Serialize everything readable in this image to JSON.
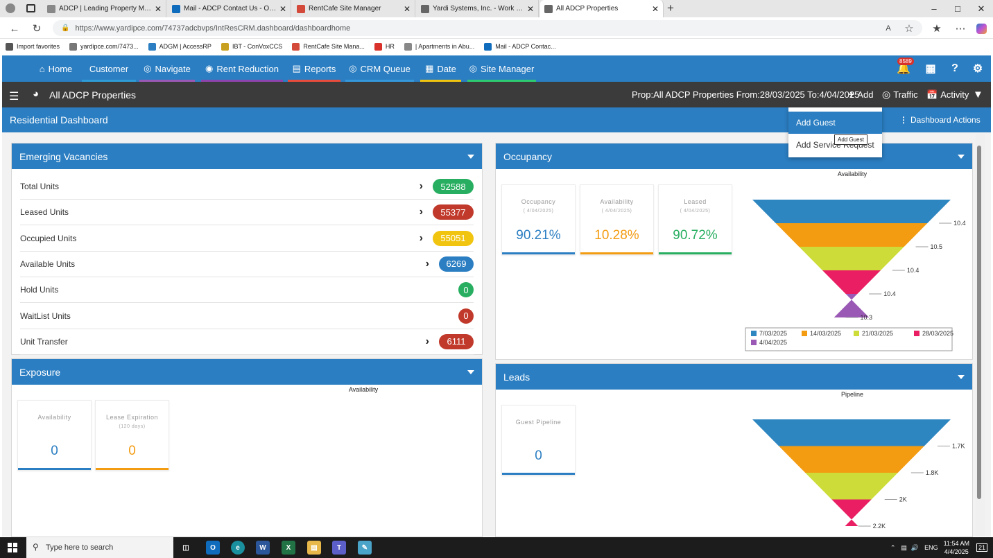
{
  "browser": {
    "tabs": [
      {
        "label": "ADCP | Leading Property Manage",
        "icon": "play-icon",
        "icon_color": "#888888"
      },
      {
        "label": "Mail - ADCP Contact Us - Outlook",
        "icon": "outlook-icon",
        "icon_color": "#0f6cbd"
      },
      {
        "label": "RentCafe Site Manager",
        "icon": "chrome-icon",
        "icon_color": "#d44a3a"
      },
      {
        "label": "Yardi Systems, Inc. - Work Order #",
        "icon": "page-icon",
        "icon_color": "#666666"
      },
      {
        "label": "All ADCP Properties",
        "icon": "page-icon",
        "icon_color": "#666666"
      }
    ],
    "url": "https://www.yardipce.com/74737adcbvps/IntResCRM.dashboard/dashboardhome",
    "favorites": [
      {
        "label": "Import favorites",
        "icon_color": "#555555"
      },
      {
        "label": "yardipce.com/7473...",
        "icon_color": "#777777"
      },
      {
        "label": "ADGM | AccessRP",
        "icon_color": "#2b7ec2"
      },
      {
        "label": "IBT - ConVoxCCS",
        "icon_color": "#c8a020"
      },
      {
        "label": "RentCafe Site Mana...",
        "icon_color": "#d44a3a"
      },
      {
        "label": "HR",
        "icon_color": "#d9322b"
      },
      {
        "label": "| Apartments in Abu...",
        "icon_color": "#888888"
      },
      {
        "label": "Mail - ADCP Contac...",
        "icon_color": "#0f6cbd"
      }
    ]
  },
  "nav": {
    "items": [
      {
        "label": "Home",
        "icon": "home-icon",
        "underline": ""
      },
      {
        "label": "Customer",
        "icon": "",
        "underline": "#2e9cd6"
      },
      {
        "label": "Navigate",
        "icon": "compass-icon",
        "underline": "#9b59b6"
      },
      {
        "label": "Rent Reduction",
        "icon": "tag-icon",
        "underline": "#8e44ad"
      },
      {
        "label": "Reports",
        "icon": "file-icon",
        "underline": "#e74c3c"
      },
      {
        "label": "CRM Queue",
        "icon": "queue-icon",
        "underline": "#3498db"
      },
      {
        "label": "Date",
        "icon": "calendar-icon",
        "underline": "#f1c40f"
      },
      {
        "label": "Site Manager",
        "icon": "gauge-icon",
        "underline": "#2ecc71"
      }
    ],
    "notification_count": "8589"
  },
  "subbar": {
    "title": "All ADCP Properties",
    "prop_info": "Prop:All ADCP Properties From:28/03/2025 To:4/04/2025",
    "add_label": "Add",
    "traffic_label": "Traffic",
    "activity_label": "Activity"
  },
  "dashboard": {
    "title": "Residential Dashboard",
    "actions_label": "Dashboard Actions"
  },
  "dropdown": {
    "items": [
      "Add Guest",
      "Add Service Request"
    ],
    "tooltip": "Add Guest"
  },
  "emerging_vacancies": {
    "title": "Emerging Vacancies",
    "rows": [
      {
        "label": "Total Units",
        "value": "52588",
        "color": "#27ae60",
        "chevron": true
      },
      {
        "label": "Leased Units",
        "value": "55377",
        "color": "#c0392b",
        "chevron": true
      },
      {
        "label": "Occupied Units",
        "value": "55051",
        "color": "#f1c40f",
        "chevron": true
      },
      {
        "label": "Available Units",
        "value": "6269",
        "color": "#2b7ec2",
        "chevron": true
      },
      {
        "label": "Hold Units",
        "value": "0",
        "color": "#27ae60",
        "chevron": false
      },
      {
        "label": "WaitList Units",
        "value": "0",
        "color": "#c0392b",
        "chevron": false
      },
      {
        "label": "Unit Transfer",
        "value": "6111",
        "color": "#c0392b",
        "chevron": true
      }
    ]
  },
  "exposure": {
    "title": "Exposure",
    "chart_title": "Availability",
    "cards": [
      {
        "title": "Availability",
        "sub": "",
        "value": "0",
        "color": "#2b7ec2"
      },
      {
        "title": "Lease Expiration",
        "sub": "(120 days)",
        "value": "0",
        "color": "#f39c12"
      }
    ]
  },
  "occupancy": {
    "title": "Occupancy",
    "chart_title": "Availability",
    "cards": [
      {
        "title": "Occupancy",
        "sub": "( 4/04/2025)",
        "value": "90.21%",
        "color": "#2b7ec2"
      },
      {
        "title": "Availability",
        "sub": "( 4/04/2025)",
        "value": "10.28%",
        "color": "#f39c12"
      },
      {
        "title": "Leased",
        "sub": "( 4/04/2025)",
        "value": "90.72%",
        "color": "#27ae60"
      }
    ]
  },
  "leads": {
    "title": "Leads",
    "chart_title": "Pipeline",
    "cards": [
      {
        "title": "Guest Pipeline",
        "sub": "",
        "value": "0",
        "color": "#2b7ec2"
      }
    ]
  },
  "chart_data": [
    {
      "type": "funnel",
      "title": "Availability",
      "categories": [
        "7/03/2025",
        "14/03/2025",
        "21/03/2025",
        "28/03/2025",
        "4/04/2025"
      ],
      "value_labels": [
        "10.4",
        "10.5",
        "10.4",
        "10.4",
        "10.3"
      ],
      "values": [
        10.4,
        10.5,
        10.4,
        10.4,
        10.3
      ],
      "colors": [
        "#2e86c1",
        "#f39c12",
        "#cddc39",
        "#e91e63",
        "#9b59b6"
      ],
      "legend": "bottom"
    },
    {
      "type": "funnel",
      "title": "Pipeline",
      "value_labels": [
        "1.7K",
        "1.8K",
        "2K",
        "2.2K"
      ],
      "values": [
        1700,
        1800,
        2000,
        2200
      ],
      "colors": [
        "#2e86c1",
        "#f39c12",
        "#cddc39",
        "#e91e63"
      ]
    }
  ],
  "taskbar": {
    "search_placeholder": "Type here to search",
    "time": "11:54 AM",
    "date": "4/4/2025",
    "lang": "ENG",
    "notif": "21"
  }
}
